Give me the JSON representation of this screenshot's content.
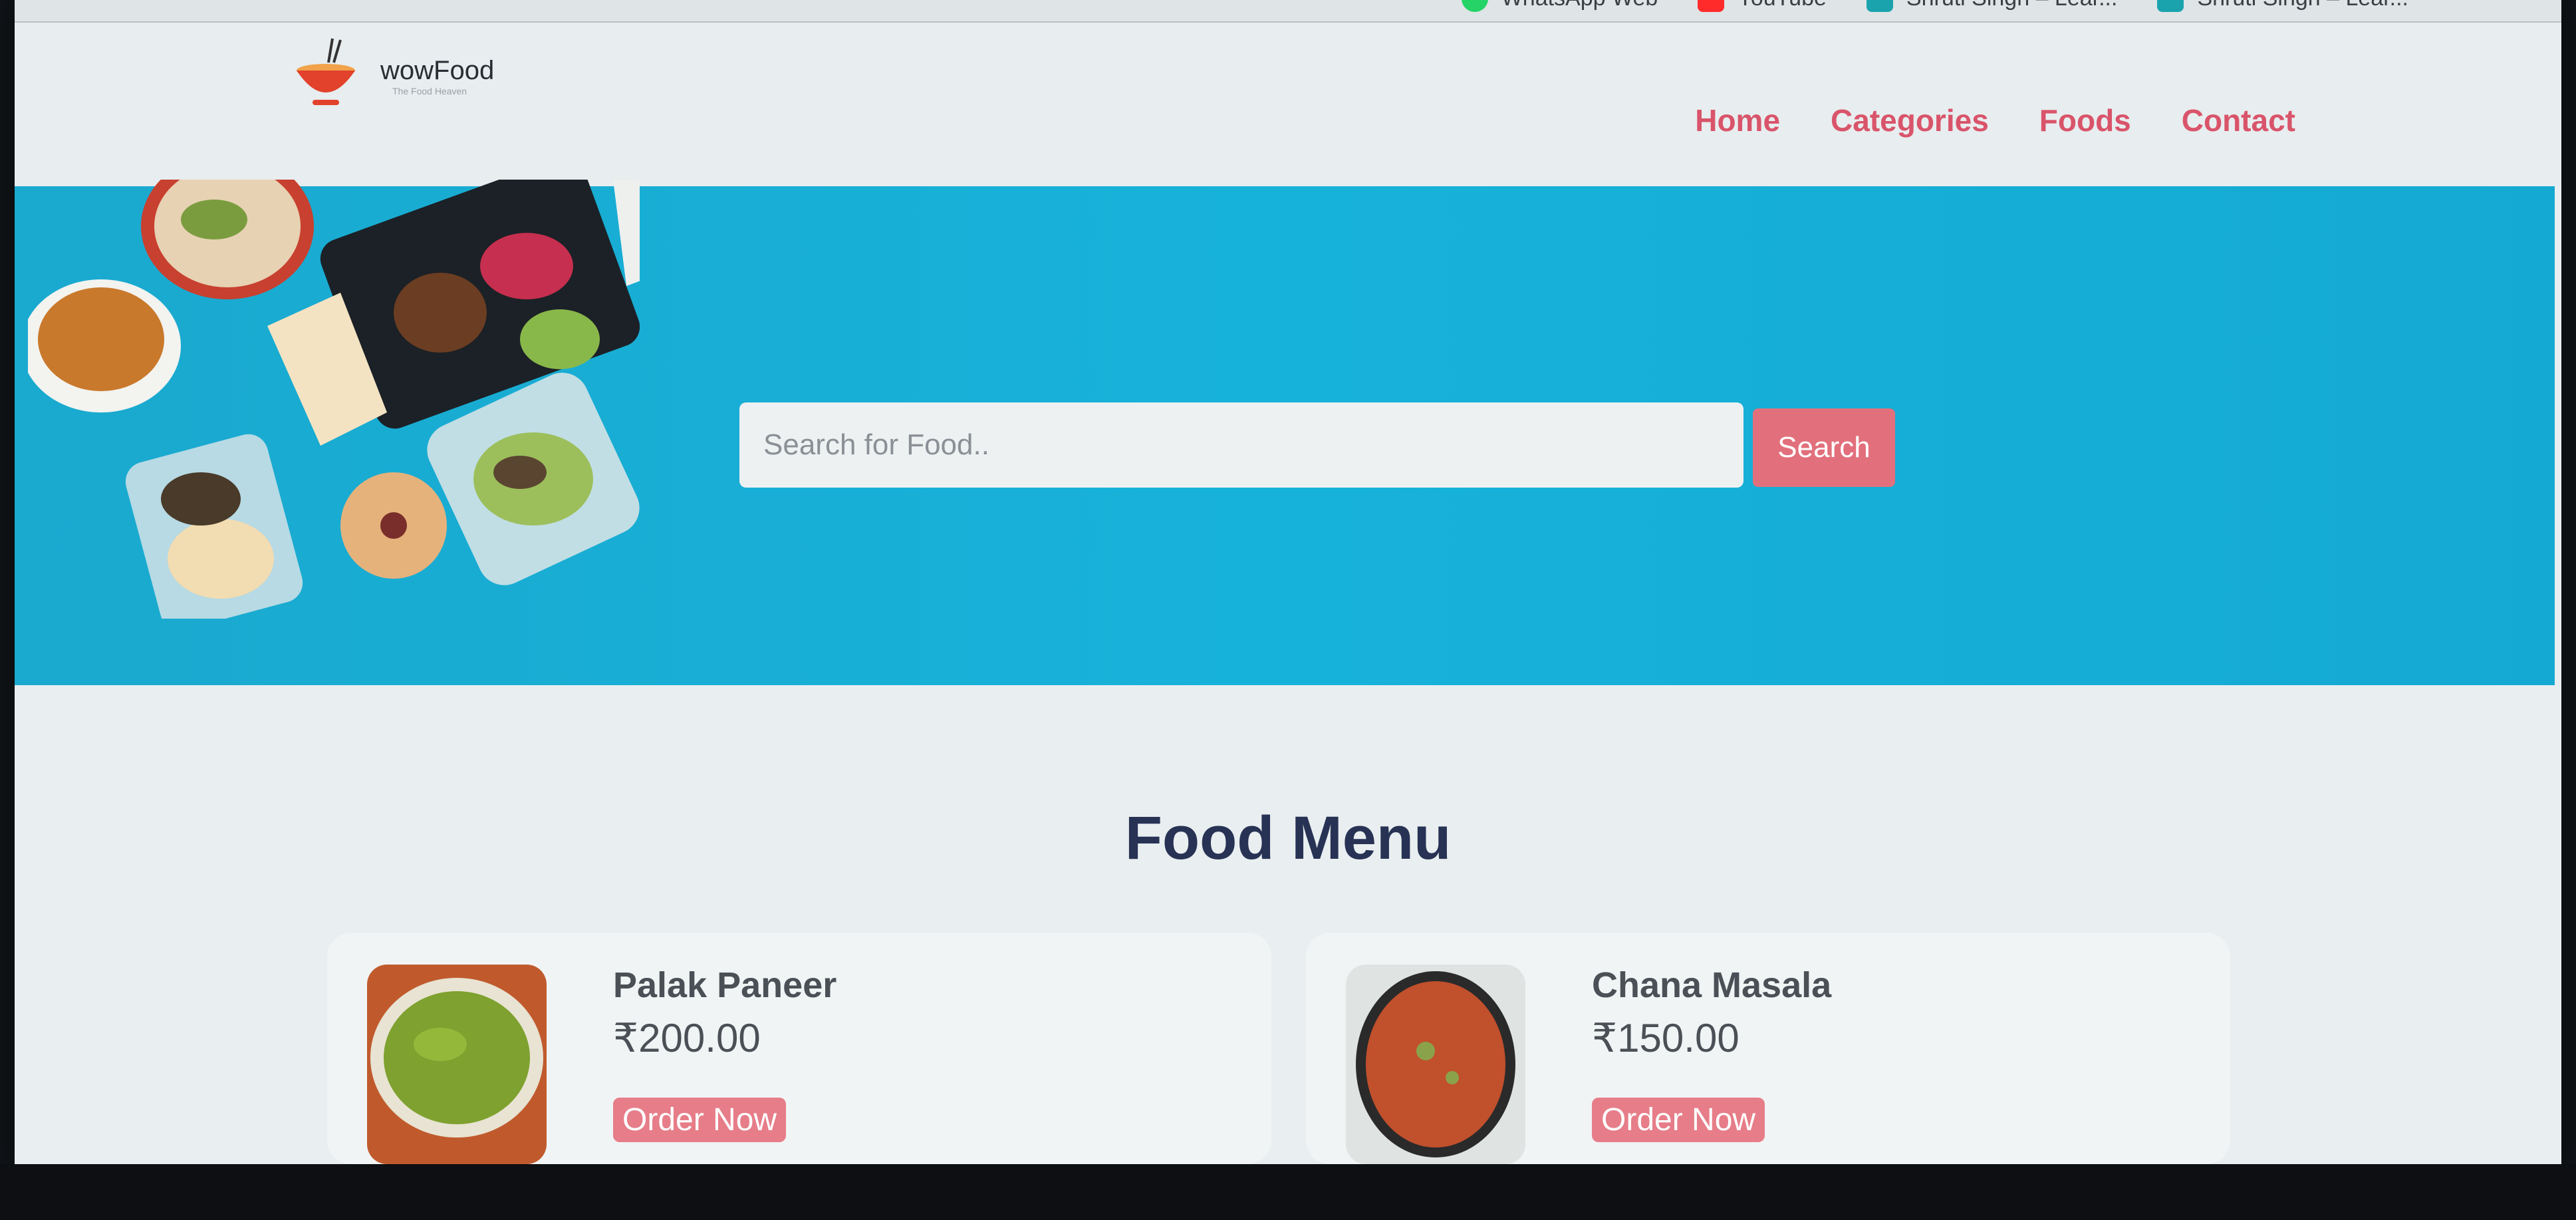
{
  "bookmarks": [
    {
      "label": "WhatsApp Web",
      "icon": "whatsapp-icon",
      "color": "#25d366"
    },
    {
      "label": "YouTube",
      "icon": "youtube-icon",
      "color": "#ff2b2b"
    },
    {
      "label": "Shruti Singh – Lear...",
      "icon": "sheets-icon",
      "color": "#1ba3ad"
    },
    {
      "label": "Shruti Singh – Lear...",
      "icon": "sheets-icon",
      "color": "#1ba3ad"
    }
  ],
  "logo": {
    "name": "wowFood",
    "tagline": "The Food Heaven"
  },
  "nav": [
    "Home",
    "Categories",
    "Foods",
    "Contact"
  ],
  "search": {
    "placeholder": "Search for Food..",
    "button": "Search"
  },
  "menu": {
    "title": "Food Menu",
    "items": [
      {
        "name": "Palak Paneer",
        "price": "₹200.00",
        "button": "Order Now"
      },
      {
        "name": "Chana Masala",
        "price": "₹150.00",
        "button": "Order Now"
      }
    ]
  },
  "colors": {
    "accent": "#d9546a",
    "hero": "#17b2da",
    "heading": "#273254"
  }
}
